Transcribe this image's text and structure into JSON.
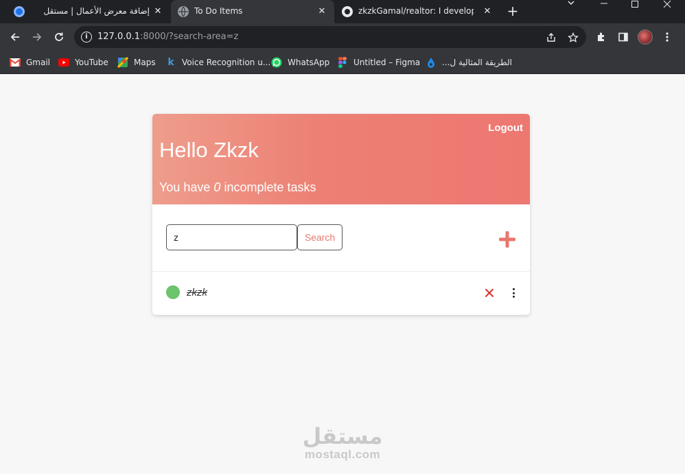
{
  "browser": {
    "tabs": [
      {
        "title": "إضافة معرض الأعمال | مستقل",
        "icon": "mostaql-favicon-icon"
      },
      {
        "title": "To Do Items",
        "icon": "globe-icon",
        "active": true
      },
      {
        "title": "zkzkGamal/realtor: I developed a",
        "icon": "github-icon"
      }
    ],
    "url": {
      "host": "127.0.0.1",
      "rest": ":8000/?search-area=z"
    },
    "bookmarks": [
      {
        "label": "Gmail",
        "icon": "gmail-icon"
      },
      {
        "label": "YouTube",
        "icon": "youtube-icon"
      },
      {
        "label": "Maps",
        "icon": "maps-icon"
      },
      {
        "label": "Voice Recognition u...",
        "icon": "k-icon"
      },
      {
        "label": "WhatsApp",
        "icon": "whatsapp-icon"
      },
      {
        "label": "Untitled – Figma",
        "icon": "figma-icon"
      },
      {
        "label": "الطريقة المثالية ل...",
        "icon": "drop-icon"
      }
    ]
  },
  "app": {
    "logout_label": "Logout",
    "greeting": "Hello Zkzk",
    "subline_prefix": "You have ",
    "incomplete_count": "0",
    "subline_suffix": " incomplete tasks",
    "search": {
      "value": "z",
      "button_label": "Search"
    },
    "tasks": [
      {
        "title": "zkzk",
        "completed": true
      }
    ],
    "colors": {
      "header_start": "#ee9d8c",
      "header_end": "#ed7871",
      "accent": "#e8776d",
      "done_dot": "#6cc46c",
      "delete": "#d9342b"
    }
  },
  "watermark": {
    "arabic": "مستقل",
    "latin": "mostaql.com"
  }
}
